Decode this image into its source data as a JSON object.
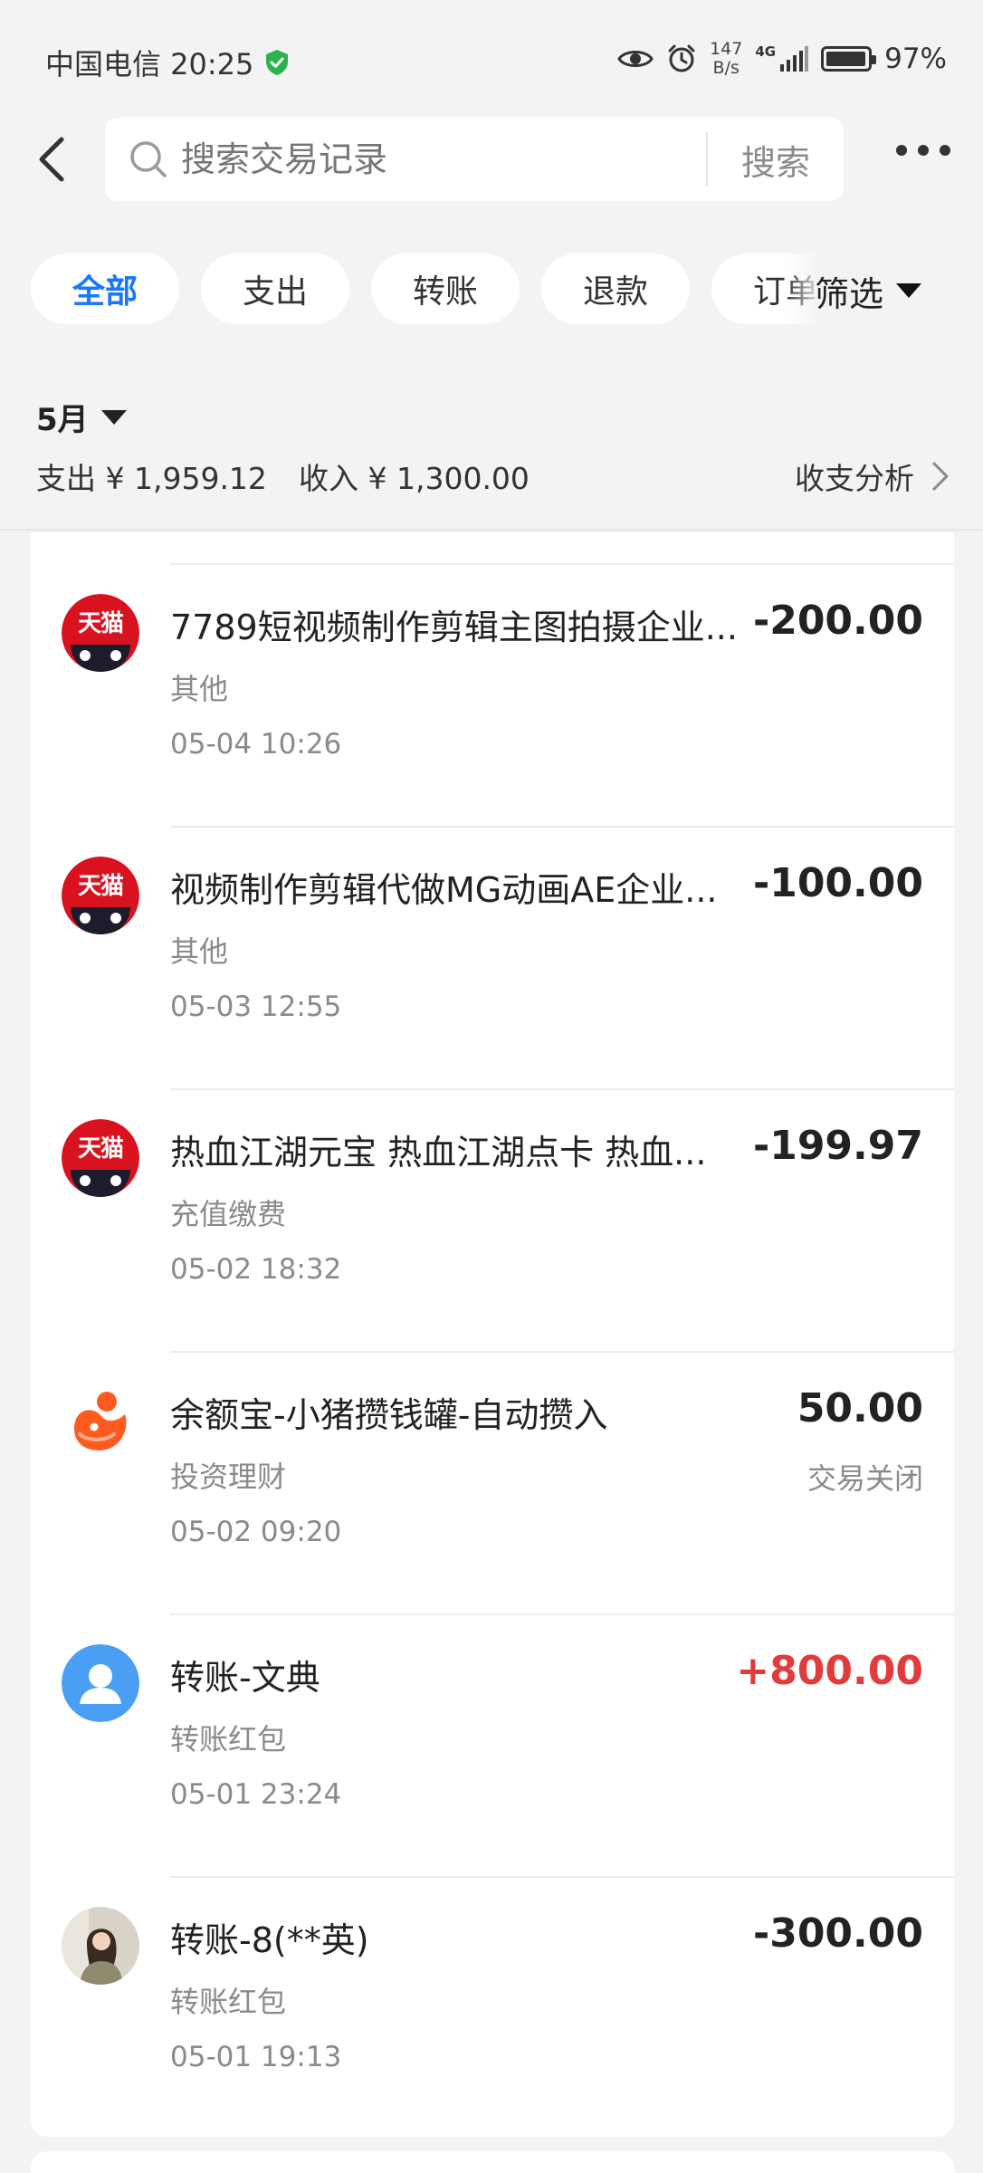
{
  "status_bar": {
    "carrier_time": "中国电信 20:25",
    "net_speed_value": "147",
    "net_speed_unit": "B/s",
    "network": "4G",
    "battery_text": "97%",
    "battery_level": 0.97
  },
  "search": {
    "placeholder": "搜索交易记录",
    "button_label": "搜索"
  },
  "filters": {
    "chips": [
      "全部",
      "支出",
      "转账",
      "退款",
      "订单"
    ],
    "active_index": 0,
    "filter_label": "筛选"
  },
  "summary": {
    "month": "5月",
    "expense": "支出 ¥ 1,959.12",
    "income": "收入 ¥ 1,300.00",
    "analysis_label": "收支分析"
  },
  "colors": {
    "accent": "#1677ff",
    "income_red": "#e23b3b",
    "tmall_red": "#d8121f",
    "yuebao_orange": "#ff5a1f",
    "transfer_blue": "#4a9ff5"
  },
  "transactions": [
    {
      "icon": "tmall-icon",
      "title": "7789短视频制作剪辑主图拍摄企业...",
      "category": "其他",
      "time": "05-04 10:26",
      "amount": "-200.00",
      "status": ""
    },
    {
      "icon": "tmall-icon",
      "title": "视频制作剪辑代做MG动画AE企业...",
      "category": "其他",
      "time": "05-03 12:55",
      "amount": "-100.00",
      "status": ""
    },
    {
      "icon": "tmall-icon",
      "title": "热血江湖元宝 热血江湖点卡 热血...",
      "category": "充值缴费",
      "time": "05-02 18:32",
      "amount": "-199.97",
      "status": ""
    },
    {
      "icon": "yuebao-icon",
      "title": "余额宝-小猪攒钱罐-自动攒入",
      "category": "投资理财",
      "time": "05-02 09:20",
      "amount": "50.00",
      "status": "交易关闭"
    },
    {
      "icon": "user-avatar-icon",
      "title": "转账-文典",
      "category": "转账红包",
      "time": "05-01 23:24",
      "amount": "+800.00",
      "status": ""
    },
    {
      "icon": "photo-avatar",
      "title": "转账-8(**英)",
      "category": "转账红包",
      "time": "05-01 19:13",
      "amount": "-300.00",
      "status": ""
    }
  ]
}
